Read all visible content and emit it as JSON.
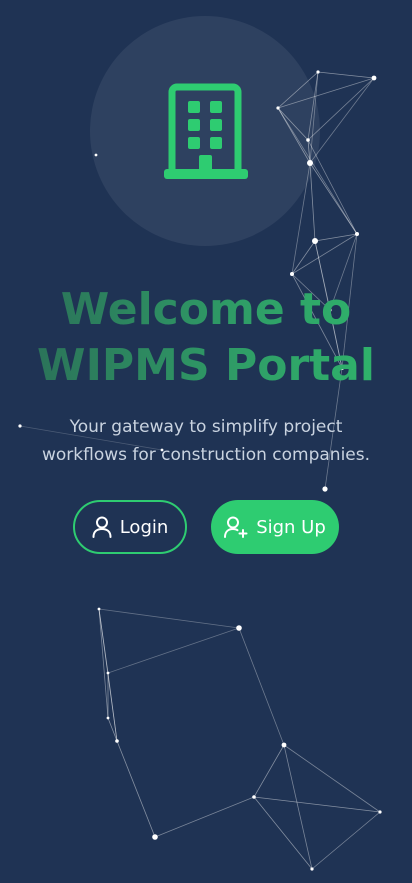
{
  "hero": {
    "icon": "building-icon",
    "title": "Welcome to WIPMS Portal",
    "subtitle": "Your gateway to simplify project workflows for construction companies."
  },
  "actions": {
    "login": {
      "label": "Login",
      "icon": "user-icon"
    },
    "signup": {
      "label": "Sign Up",
      "icon": "user-plus-icon"
    }
  },
  "colors": {
    "background": "#1f3354",
    "accent": "#2ecc71",
    "title_gradient_start": "#2a6c57",
    "title_gradient_end": "#2fb86c",
    "subtitle": "#c9d3e0"
  }
}
